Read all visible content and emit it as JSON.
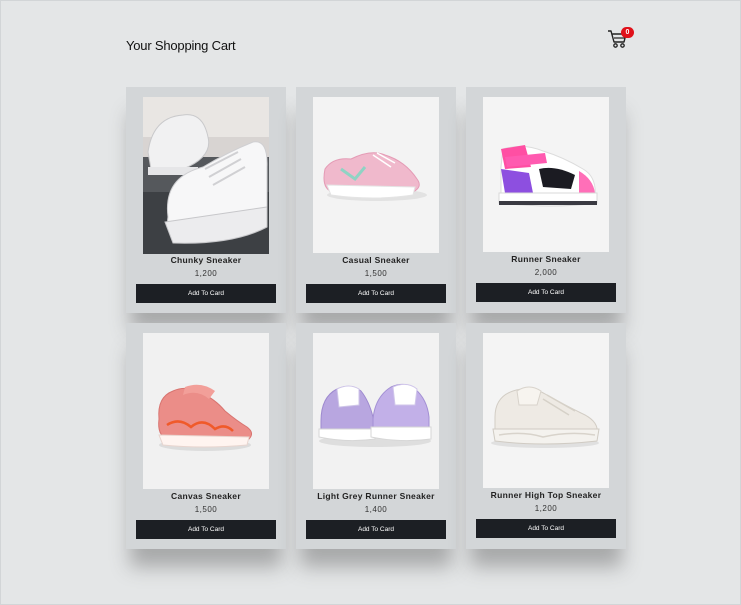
{
  "header": {
    "title": "Your Shopping Cart",
    "cart_icon": "shopping-cart-icon",
    "cart_count": "0"
  },
  "colors": {
    "background": "#e4e6e7",
    "card": "#d3d6d8",
    "button": "#1c1f24",
    "badge": "#e0111a"
  },
  "products": [
    {
      "name": "Chunky Sneaker",
      "price": "1,200",
      "button": "Add To Card",
      "image": "white-chunky-sneaker"
    },
    {
      "name": "Casual Sneaker",
      "price": "1,500",
      "button": "Add To Card",
      "image": "pink-casual-sneaker"
    },
    {
      "name": "Runner Sneaker",
      "price": "2,000",
      "button": "Add To Card",
      "image": "pink-purple-high-top-sneaker"
    },
    {
      "name": "Canvas Sneaker",
      "price": "1,500",
      "button": "Add To Card",
      "image": "coral-knit-sneaker"
    },
    {
      "name": "Light Grey Runner Sneaker",
      "price": "1,400",
      "button": "Add To Card",
      "image": "lavender-sneaker-pair"
    },
    {
      "name": "Runner High Top Sneaker",
      "price": "1,200",
      "button": "Add To Card",
      "image": "cream-runner-sneaker"
    }
  ]
}
